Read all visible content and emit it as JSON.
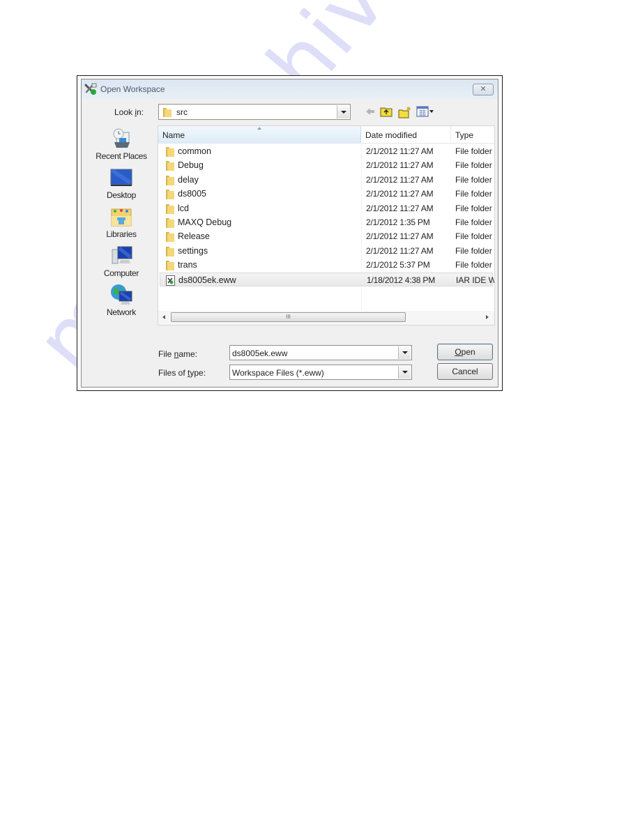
{
  "dialog": {
    "title": "Open Workspace",
    "close_label": "✕",
    "app_icon": "iar-workspace-icon"
  },
  "look_in": {
    "label": "Look in:",
    "label_access_key": "i",
    "value": "src",
    "icon": "folder-icon"
  },
  "toolbar": {
    "icons": [
      "back-arrow-icon",
      "up-one-level-icon",
      "new-folder-icon",
      "view-menu-icon"
    ]
  },
  "places": [
    {
      "label": "Recent Places",
      "icon": "recent-places-icon"
    },
    {
      "label": "Desktop",
      "icon": "desktop-icon"
    },
    {
      "label": "Libraries",
      "icon": "libraries-icon"
    },
    {
      "label": "Computer",
      "icon": "computer-icon"
    },
    {
      "label": "Network",
      "icon": "network-icon"
    }
  ],
  "file_list": {
    "columns": [
      "Name",
      "Date modified",
      "Type"
    ],
    "sorted_by": "Name",
    "rows": [
      {
        "name": "common",
        "date": "2/1/2012 11:27 AM",
        "type": "File folder",
        "kind": "folder"
      },
      {
        "name": "Debug",
        "date": "2/1/2012 11:27 AM",
        "type": "File folder",
        "kind": "folder"
      },
      {
        "name": "delay",
        "date": "2/1/2012 11:27 AM",
        "type": "File folder",
        "kind": "folder"
      },
      {
        "name": "ds8005",
        "date": "2/1/2012 11:27 AM",
        "type": "File folder",
        "kind": "folder"
      },
      {
        "name": "lcd",
        "date": "2/1/2012 11:27 AM",
        "type": "File folder",
        "kind": "folder"
      },
      {
        "name": "MAXQ Debug",
        "date": "2/1/2012 1:35 PM",
        "type": "File folder",
        "kind": "folder"
      },
      {
        "name": "Release",
        "date": "2/1/2012 11:27 AM",
        "type": "File folder",
        "kind": "folder"
      },
      {
        "name": "settings",
        "date": "2/1/2012 11:27 AM",
        "type": "File folder",
        "kind": "folder"
      },
      {
        "name": "trans",
        "date": "2/1/2012 5:37 PM",
        "type": "File folder",
        "kind": "folder"
      },
      {
        "name": "ds8005ek.eww",
        "date": "1/18/2012 4:38 PM",
        "type": "IAR IDE W",
        "kind": "workspace",
        "selected": true
      }
    ],
    "scrollbar_grip": "III"
  },
  "file_name": {
    "label_pre": "File ",
    "label_key": "n",
    "label_post": "ame:",
    "value": "ds8005ek.eww"
  },
  "file_type": {
    "label_pre": "Files of ",
    "label_key": "t",
    "label_post": "ype:",
    "value": "Workspace Files (*.eww)"
  },
  "buttons": {
    "open_key": "O",
    "open_rest": "pen",
    "cancel": "Cancel"
  },
  "watermark": "manualshive.com"
}
